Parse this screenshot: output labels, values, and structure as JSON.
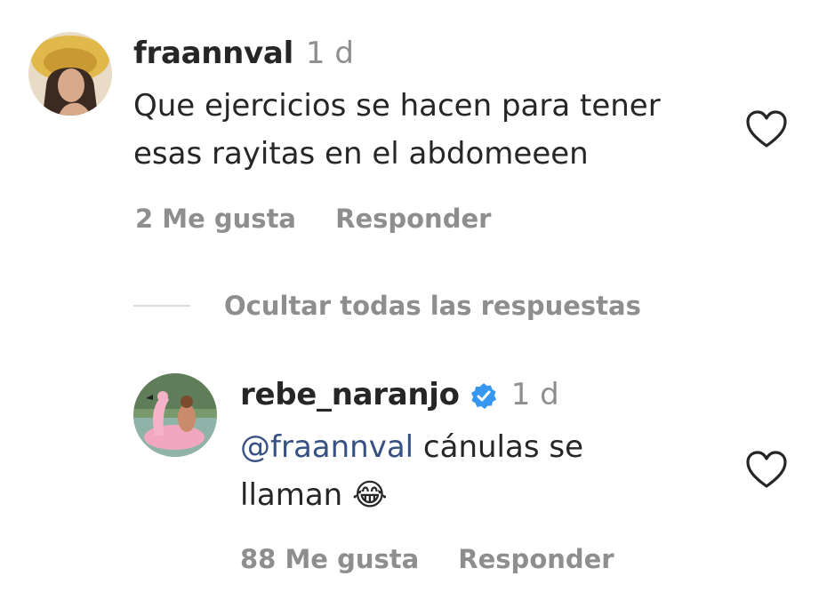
{
  "comment": {
    "username": "fraannval",
    "time": "1 d",
    "text_line1": "Que ejercicios se hacen para tener",
    "text_line2": "esas rayitas en el abdomeeen",
    "likes": "2 Me gusta",
    "reply": "Responder"
  },
  "thread": {
    "hide_replies": "Ocultar todas las respuestas"
  },
  "reply": {
    "username": "rebe_naranjo",
    "time": "1 d",
    "mention": "@fraannval",
    "text_rest": " cánulas se",
    "text_line2": "llaman",
    "emoji": "😂",
    "likes": "88 Me gusta",
    "reply": "Responder"
  },
  "icons": {
    "like": "heart-outline-icon",
    "verified": "verified-badge-icon"
  },
  "colors": {
    "verified": "#3897f0",
    "mention": "#385185",
    "secondary_text": "#8e8e8e"
  }
}
